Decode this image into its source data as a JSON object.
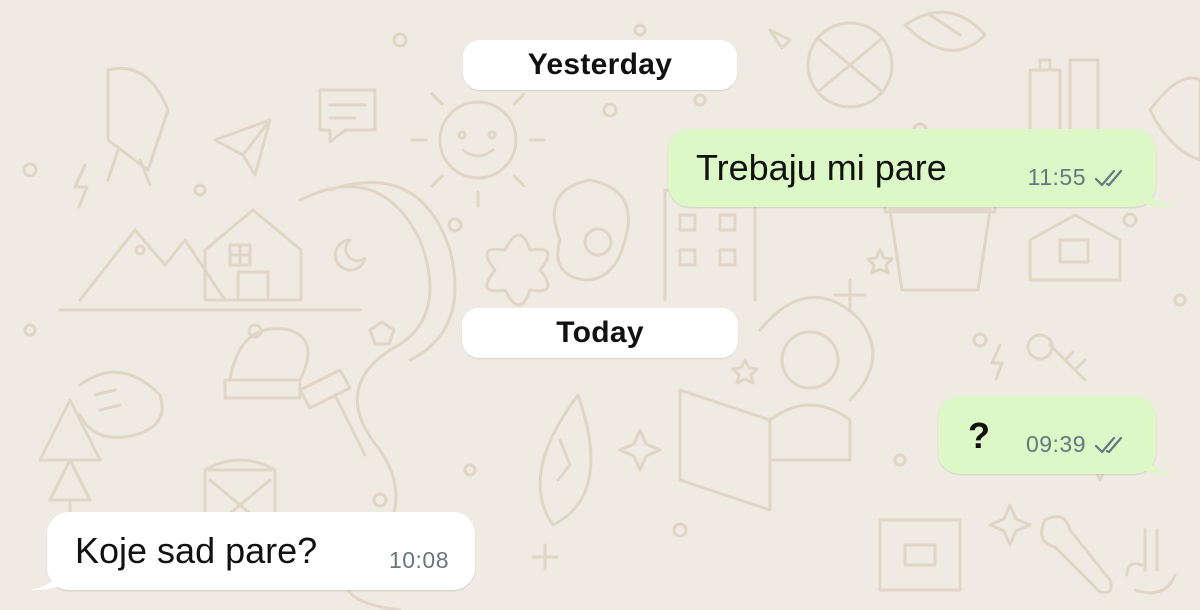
{
  "colors": {
    "wallpaper": "#efeae2",
    "outgoing_bubble": "#dcf8c6",
    "incoming_bubble": "#ffffff",
    "date_chip": "#ffffff",
    "timestamp": "#667781",
    "read_ticks": "#667781"
  },
  "chat": {
    "date_separators": [
      {
        "label": "Yesterday"
      },
      {
        "label": "Today"
      }
    ],
    "messages": [
      {
        "direction": "outgoing",
        "text": "Trebaju mi pare",
        "time": "11:55",
        "status_icon": "double-check-icon"
      },
      {
        "direction": "outgoing",
        "text": "?",
        "time": "09:39",
        "status_icon": "double-check-icon"
      },
      {
        "direction": "incoming",
        "text": "Koje sad pare?",
        "time": "10:08"
      }
    ]
  }
}
